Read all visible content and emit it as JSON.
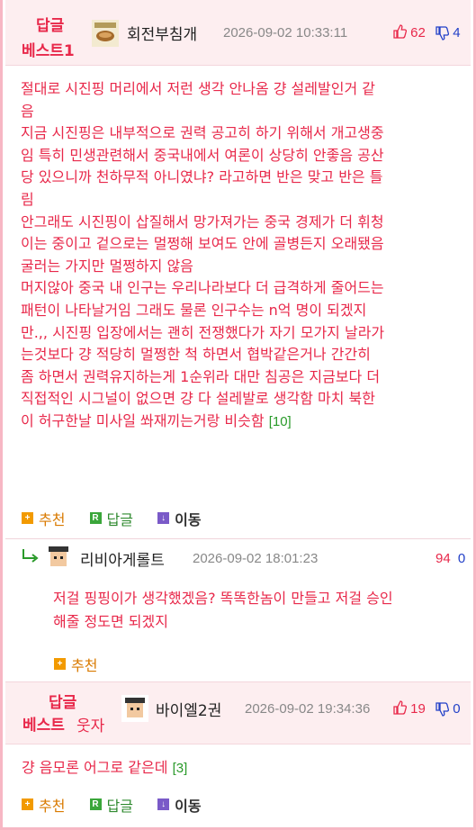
{
  "comments": [
    {
      "badge": [
        "답글",
        "베스트1"
      ],
      "nickname": "회전부침개",
      "date": "2026-09-02 10:33:11",
      "up": "62",
      "down": "4",
      "lines": [
        "절대로 시진핑 머리에서 저런 생각 안나옴 걍 설레발인거 같",
        "음",
        "지금 시진핑은 내부적으로 권력 공고히 하기 위해서 개고생중",
        "임 특히 민생관련해서 중국내에서 여론이 상당히 안좋음 공산",
        "당 있으니까 천하무적 아니였냐? 라고하면 반은 맞고 반은 틀",
        "림",
        "안그래도 시진핑이 삽질해서 망가져가는 중국 경제가 더 휘청",
        "이는 중이고 겉으로는 멀쩡해 보여도 안에 골병든지 오래됐음",
        "굴러는 가지만 멀쩡하지 않음",
        "머지않아 중국 내 인구는 우리나라보다 더 급격하게 줄어드는",
        "패턴이 나타날거임 그래도 물론 인구수는 n억 명이 되겠지",
        "만.,, 시진핑 입장에서는 괜히 전쟁했다가 자기 모가지 날라가",
        "는것보다 걍 적당히 멀쩡한 척 하면서 협박같은거나 간간히",
        "좀 하면서 권력유지하는게 1순위라 대만 침공은 지금보다 더",
        "직접적인 시그널이 없으면 걍 다 설레발로 생각함 마치 북한",
        "이 허구한날 미사일 쏴재끼는거랑 비슷함"
      ],
      "reply_count": "[10]",
      "actions": {
        "recommend": "추천",
        "reply": "답글",
        "move": "이동"
      }
    },
    {
      "nickname": "리비아게롤트",
      "date": "2026-09-02 18:01:23",
      "up": "94",
      "down": "0",
      "lines": [
        "저걸 핑핑이가 생각했겠음? 똑똑한놈이 만들고 저걸 승인",
        "해줄 정도면 되겠지"
      ],
      "actions": {
        "recommend": "추천"
      }
    },
    {
      "badge": [
        "답글",
        "베스트"
      ],
      "badge_extra": "웃자",
      "nickname": "바이엘2권",
      "date": "2026-09-02 19:34:36",
      "up": "19",
      "down": "0",
      "lines": [
        "걍 음모론 어그로 같은데"
      ],
      "reply_count": "[3]",
      "actions": {
        "recommend": "추천",
        "reply": "답글",
        "move": "이동"
      }
    }
  ],
  "icons": [
    "thumbs-up-icon",
    "thumbs-down-icon",
    "reply-arrow-icon",
    "plus-icon",
    "r-icon",
    "down-arrow-icon"
  ],
  "colors": {
    "accent": "#e8284a",
    "border": "#f7b7c4",
    "header_bg": "#fdeef0",
    "down": "#2240c8"
  }
}
